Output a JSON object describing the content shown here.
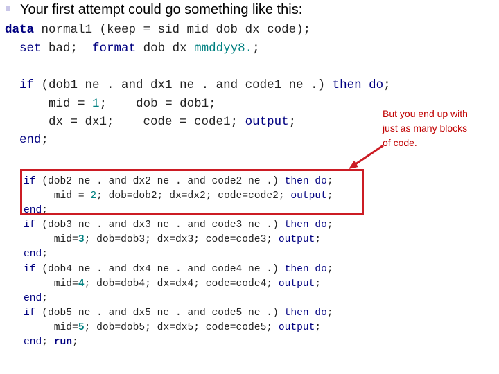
{
  "slide": {
    "bullet_text": "Your first attempt could go something like this:",
    "annotation": {
      "line1": "But you end up with",
      "line2": "just as many blocks",
      "line3": "of code."
    },
    "colors": {
      "keyword": "#000080",
      "number": "#008080",
      "text": "#222222",
      "highlight_box": "#cc1c24",
      "annotation": "#c00000"
    }
  },
  "code_header": {
    "l1": {
      "kw": "data",
      "rest": " normal1 (keep = sid mid dob dx code);"
    },
    "l2": {
      "kw1": "set",
      "mid": " bad;  ",
      "kw2": "format",
      "mid2": " dob dx ",
      "fmt": "mmddyy8.",
      "end": ";"
    }
  },
  "block1": {
    "if_kw": "if",
    "cond": " (dob1 ne . and dx1 ne . and code1 ne .) ",
    "then_kw": "then do",
    "semi": ";",
    "l2a": "    mid = ",
    "l2num": "1",
    "l2b": ";    dob = dob1;",
    "l3a": "    dx = dx1;    code = code1; ",
    "l3kw": "output",
    "l3b": ";",
    "end_kw": "end",
    "end_semi": ";"
  },
  "blocks": [
    {
      "if_kw": "if",
      "cond": " (dob2 ne . and dx2 ne . and code2 ne .) ",
      "then_kw": "then do",
      "semi": ";",
      "body_a": "     mid = ",
      "num": "2",
      "body_b": "; dob=dob2; dx=dx2; code=code2; ",
      "out_kw": "output",
      "out_semi": ";",
      "end_kw": "end",
      "end_semi": ";"
    },
    {
      "if_kw": "if",
      "cond": " (dob3 ne . and dx3 ne . and code3 ne .) ",
      "then_kw": "then do",
      "semi": ";",
      "body_a": "     mid=",
      "num": "3",
      "body_b": "; dob=dob3; dx=dx3; code=code3; ",
      "out_kw": "output",
      "out_semi": ";",
      "end_kw": "end",
      "end_semi": ";"
    },
    {
      "if_kw": "if",
      "cond": " (dob4 ne . and dx4 ne . and code4 ne .) ",
      "then_kw": "then do",
      "semi": ";",
      "body_a": "     mid=",
      "num": "4",
      "body_b": "; dob=dob4; dx=dx4; code=code4; ",
      "out_kw": "output",
      "out_semi": ";",
      "end_kw": "end",
      "end_semi": ";"
    },
    {
      "if_kw": "if",
      "cond": " (dob5 ne . and dx5 ne . and code5 ne .) ",
      "then_kw": "then do",
      "semi": ";",
      "body_a": "     mid=",
      "num": "5",
      "body_b": "; dob=dob5; dx=dx5; code=code5; ",
      "out_kw": "output",
      "out_semi": ";",
      "end_kw": "end",
      "end_semi": "; ",
      "run_kw": "run",
      "run_semi": ";"
    }
  ]
}
